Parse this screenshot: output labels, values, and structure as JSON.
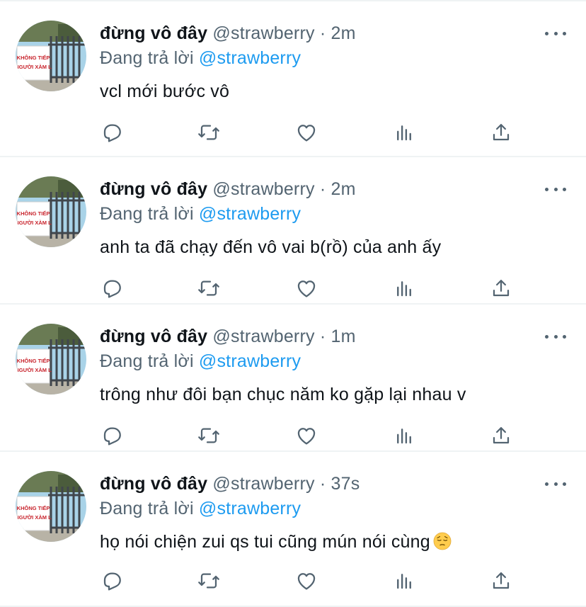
{
  "tweets": [
    {
      "display_name": "đừng vô đây",
      "handle": "@strawberry",
      "separator": "·",
      "time": "2m",
      "replying_prefix": "Đang trả lời",
      "replying_to": "@strawberry",
      "text": "vcl mới bước vô",
      "emoji": "",
      "avatar_sign_lines": [
        "KHÔNG TIẾP",
        "NGƯỜI XÀM L"
      ]
    },
    {
      "display_name": "đừng vô đây",
      "handle": "@strawberry",
      "separator": "·",
      "time": "2m",
      "replying_prefix": "Đang trả lời",
      "replying_to": "@strawberry",
      "text": "anh ta đã chạy đến vô vai b(rồ) của anh ấy",
      "emoji": "",
      "avatar_sign_lines": [
        "KHÔNG TIẾP",
        "NGƯỜI XÀM L"
      ]
    },
    {
      "display_name": "đừng vô đây",
      "handle": "@strawberry",
      "separator": "·",
      "time": "1m",
      "replying_prefix": "Đang trả lời",
      "replying_to": "@strawberry",
      "text": "trông như đôi bạn chục năm ko gặp lại nhau v",
      "emoji": "",
      "avatar_sign_lines": [
        "KHÔNG TIẾP",
        "NGƯỜI XÀM L"
      ]
    },
    {
      "display_name": "đừng vô đây",
      "handle": "@strawberry",
      "separator": "·",
      "time": "37s",
      "replying_prefix": "Đang trả lời",
      "replying_to": "@strawberry",
      "text": "họ nói chiện zui qs tui cũng mún nói cùng",
      "emoji": "pensive-face",
      "avatar_sign_lines": [
        "KHÔNG TIẾP",
        "NGƯỜI XÀM L"
      ]
    }
  ],
  "actions": [
    {
      "icon": "reply-icon"
    },
    {
      "icon": "retweet-icon"
    },
    {
      "icon": "like-icon"
    },
    {
      "icon": "analytics-icon"
    },
    {
      "icon": "share-icon"
    }
  ],
  "colors": {
    "text_primary": "#0f1419",
    "text_secondary": "#536471",
    "accent": "#1d9bf0",
    "divider": "#eff3f4",
    "sign_red": "#c8232c"
  }
}
